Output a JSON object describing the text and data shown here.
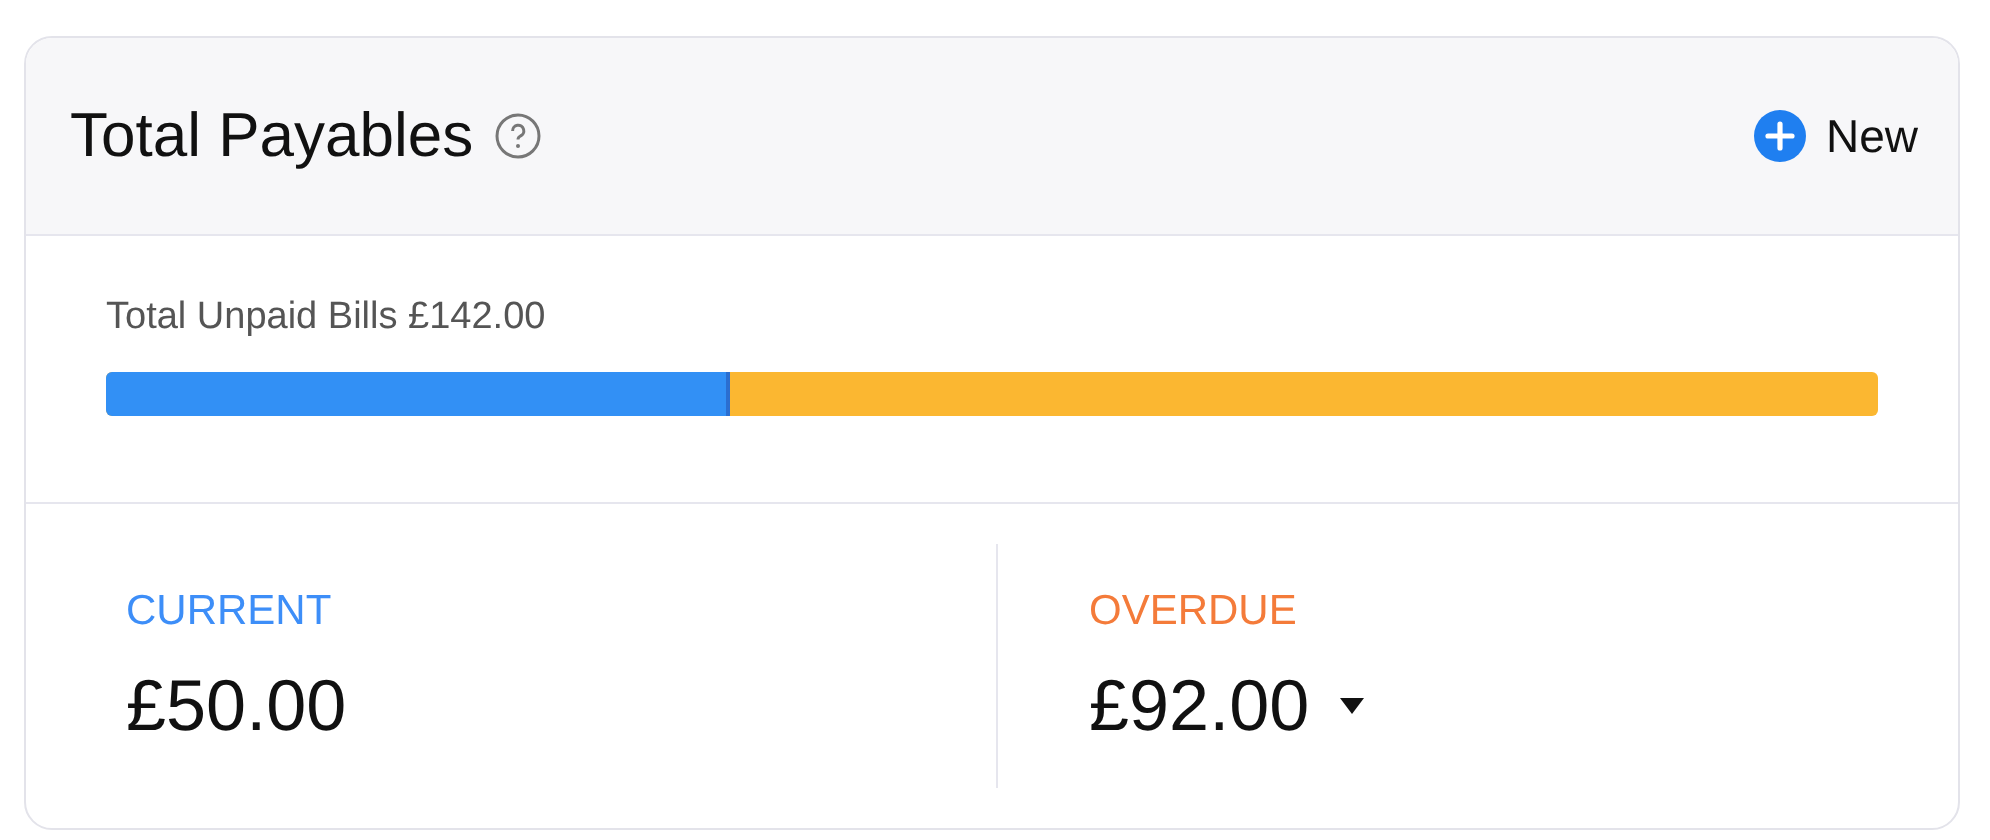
{
  "header": {
    "title": "Total Payables",
    "new_button": "New"
  },
  "unpaid": {
    "label": "Total Unpaid Bills £142.00",
    "level": 0.352
  },
  "buckets": [
    {
      "label": "CURRENT",
      "amount": "£50.00",
      "color": "#3d8ef8",
      "has_menu": false
    },
    {
      "label": "OVERDUE",
      "amount": "£92.00",
      "color": "#f47b3a",
      "has_menu": true
    }
  ]
}
